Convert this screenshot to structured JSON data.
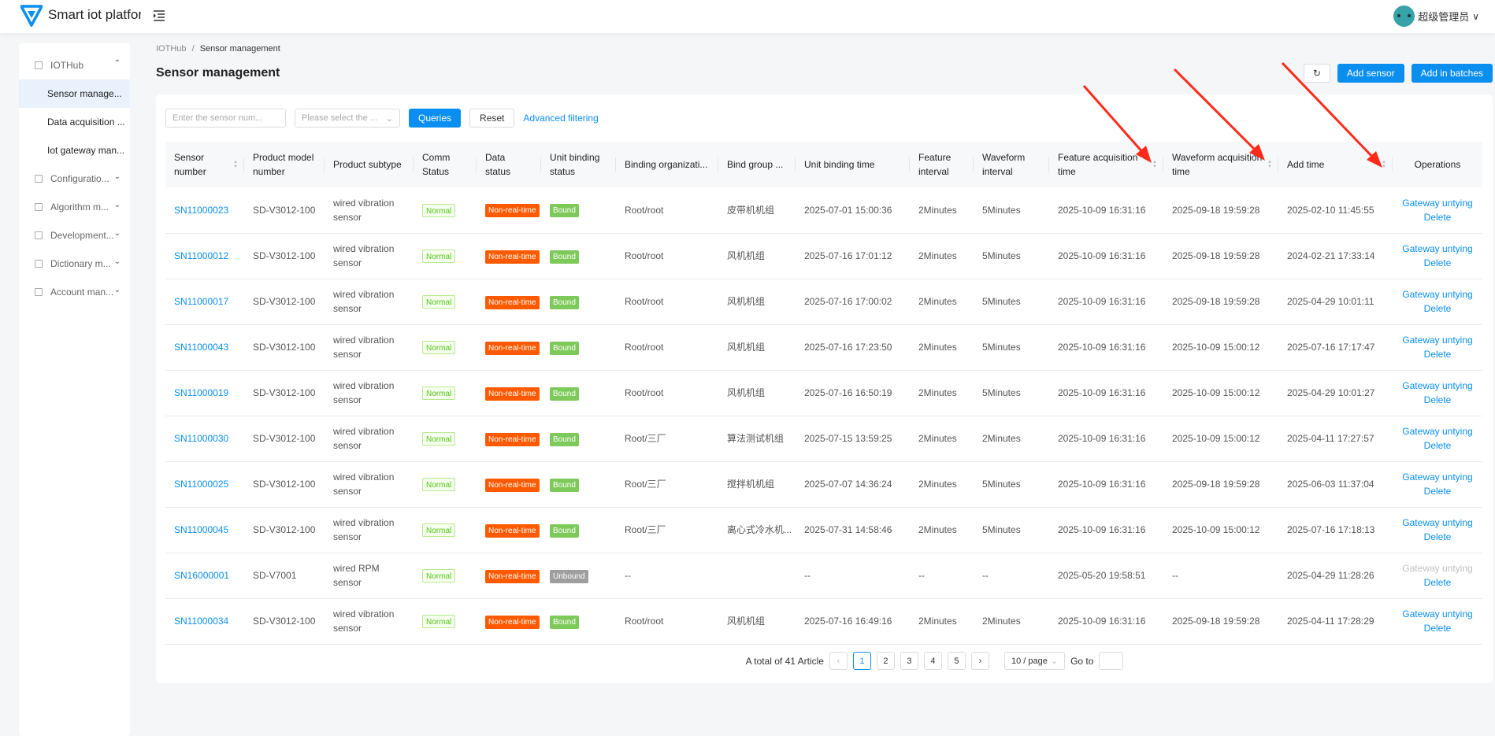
{
  "header": {
    "brand": "Smart iot platfor",
    "user": "超级管理员"
  },
  "sidebar": {
    "groups": [
      {
        "label": "IOTHub",
        "expanded": true,
        "children": [
          "Sensor manage...",
          "Data acquisition ...",
          "Iot gateway man..."
        ]
      },
      {
        "label": "Configuratio..."
      },
      {
        "label": "Algorithm m..."
      },
      {
        "label": "Development..."
      },
      {
        "label": "Dictionary m..."
      },
      {
        "label": "Account man..."
      }
    ]
  },
  "breadcrumb": {
    "parent": "IOTHub",
    "separator": "/",
    "current": "Sensor management"
  },
  "page_title": "Sensor management",
  "toolbar": {
    "add_sensor": "Add sensor",
    "add_batches": "Add in batches"
  },
  "filters": {
    "sensor_placeholder": "Enter the sensor num...",
    "select_placeholder": "Please select the ...",
    "query": "Queries",
    "reset": "Reset",
    "advanced": "Advanced filtering"
  },
  "table": {
    "columns": [
      "Sensor number",
      "Product model number",
      "Product subtype",
      "Comm Status",
      "Data status",
      "Unit binding status",
      "Binding organizati...",
      "Bind group ...",
      "Unit binding time",
      "Feature interval",
      "Waveform interval",
      "Feature acquisition time",
      "Waveform acquisition time",
      "Add time",
      "Operations"
    ],
    "sortable": [
      true,
      false,
      false,
      false,
      false,
      false,
      false,
      false,
      false,
      false,
      false,
      true,
      true,
      true,
      false
    ],
    "rows": [
      [
        "SN11000023",
        "SD-V3012-100",
        "wired vibration sensor",
        "Normal",
        "Non-real-time",
        "Bound",
        "Root/root",
        "皮带机机组",
        "2025-07-01 15:00:36",
        "2Minutes",
        "5Minutes",
        "2025-10-09 16:31:16",
        "2025-09-18 19:59:28",
        "2025-02-10 11:45:55"
      ],
      [
        "SN11000012",
        "SD-V3012-100",
        "wired vibration sensor",
        "Normal",
        "Non-real-time",
        "Bound",
        "Root/root",
        "风机机组",
        "2025-07-16 17:01:12",
        "2Minutes",
        "5Minutes",
        "2025-10-09 16:31:16",
        "2025-09-18 19:59:28",
        "2024-02-21 17:33:14"
      ],
      [
        "SN11000017",
        "SD-V3012-100",
        "wired vibration sensor",
        "Normal",
        "Non-real-time",
        "Bound",
        "Root/root",
        "风机机组",
        "2025-07-16 17:00:02",
        "2Minutes",
        "5Minutes",
        "2025-10-09 16:31:16",
        "2025-09-18 19:59:28",
        "2025-04-29 10:01:11"
      ],
      [
        "SN11000043",
        "SD-V3012-100",
        "wired vibration sensor",
        "Normal",
        "Non-real-time",
        "Bound",
        "Root/root",
        "风机机组",
        "2025-07-16 17:23:50",
        "2Minutes",
        "5Minutes",
        "2025-10-09 16:31:16",
        "2025-10-09 15:00:12",
        "2025-07-16 17:17:47"
      ],
      [
        "SN11000019",
        "SD-V3012-100",
        "wired vibration sensor",
        "Normal",
        "Non-real-time",
        "Bound",
        "Root/root",
        "风机机组",
        "2025-07-16 16:50:19",
        "2Minutes",
        "5Minutes",
        "2025-10-09 16:31:16",
        "2025-10-09 15:00:12",
        "2025-04-29 10:01:27"
      ],
      [
        "SN11000030",
        "SD-V3012-100",
        "wired vibration sensor",
        "Normal",
        "Non-real-time",
        "Bound",
        "Root/三厂",
        "算法测试机组",
        "2025-07-15 13:59:25",
        "2Minutes",
        "2Minutes",
        "2025-10-09 16:31:16",
        "2025-10-09 15:00:12",
        "2025-04-11 17:27:57"
      ],
      [
        "SN11000025",
        "SD-V3012-100",
        "wired vibration sensor",
        "Normal",
        "Non-real-time",
        "Bound",
        "Root/三厂",
        "搅拌机机组",
        "2025-07-07 14:36:24",
        "2Minutes",
        "5Minutes",
        "2025-10-09 16:31:16",
        "2025-09-18 19:59:28",
        "2025-06-03 11:37:04"
      ],
      [
        "SN11000045",
        "SD-V3012-100",
        "wired vibration sensor",
        "Normal",
        "Non-real-time",
        "Bound",
        "Root/三厂",
        "离心式冷水机...",
        "2025-07-31 14:58:46",
        "2Minutes",
        "5Minutes",
        "2025-10-09 16:31:16",
        "2025-10-09 15:00:12",
        "2025-07-16 17:18:13"
      ],
      [
        "SN16000001",
        "SD-V7001",
        "wired RPM sensor",
        "Normal",
        "Non-real-time",
        "Unbound",
        "--",
        "",
        "--",
        "--",
        "--",
        "2025-05-20 19:58:51",
        "--",
        "2025-04-29 11:28:26"
      ],
      [
        "SN11000034",
        "SD-V3012-100",
        "wired vibration sensor",
        "Normal",
        "Non-real-time",
        "Bound",
        "Root/root",
        "风机机组",
        "2025-07-16 16:49:16",
        "2Minutes",
        "2Minutes",
        "2025-10-09 16:31:16",
        "2025-09-18 19:59:28",
        "2025-04-11 17:28:29"
      ]
    ],
    "ops": {
      "untie": "Gateway untying",
      "delete": "Delete"
    },
    "untie_disabled": [
      false,
      false,
      false,
      false,
      false,
      false,
      false,
      false,
      true,
      false
    ]
  },
  "pagination": {
    "total": "A total of 41 Article",
    "pages": [
      "1",
      "2",
      "3",
      "4",
      "5"
    ],
    "current": "1",
    "page_size": "10 / page",
    "goto": "Go to"
  },
  "colors": {
    "primary": "#0a8ff0",
    "non_real_time": "#ff5a00",
    "bound": "#7dca5a",
    "unbound": "#9e9e9e",
    "arrow": "#ff2a1a"
  }
}
